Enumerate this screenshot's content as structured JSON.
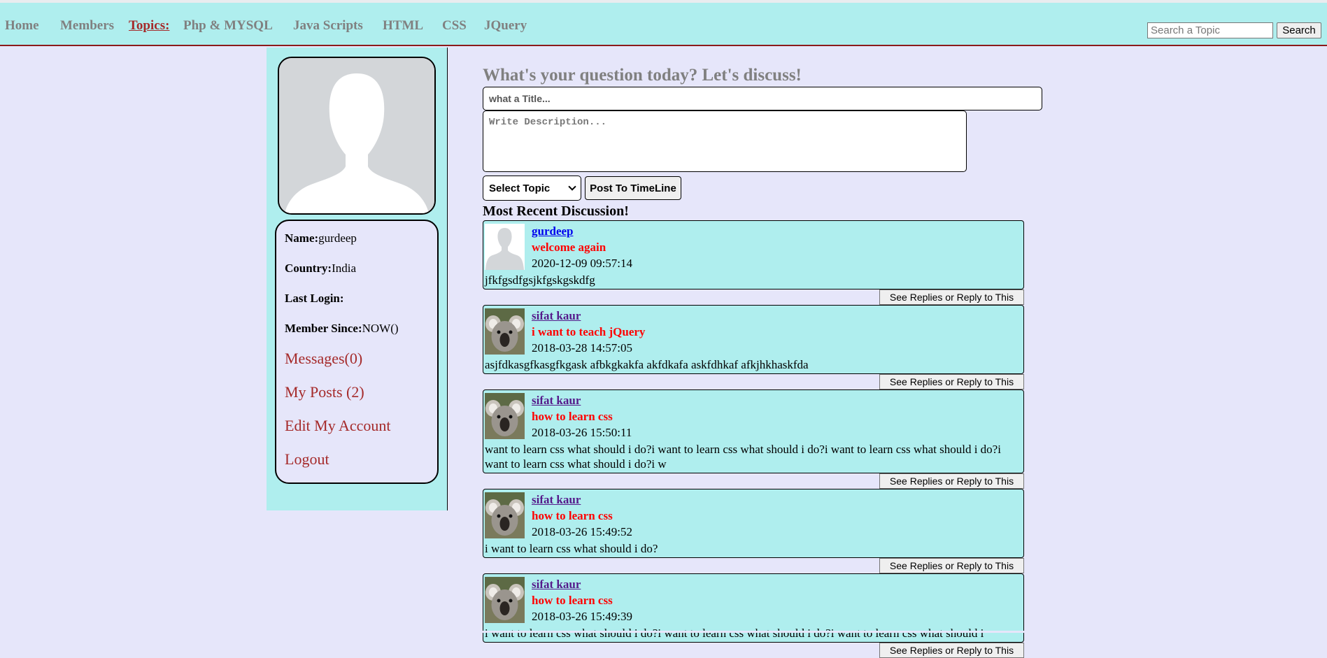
{
  "nav": {
    "home": "Home",
    "members": "Members",
    "topics": "Topics:",
    "php": "Php & MYSQL",
    "js": "Java Scripts",
    "html": "HTML",
    "css": "CSS",
    "jquery": "JQuery"
  },
  "search": {
    "placeholder": "Search a Topic",
    "button": "Search"
  },
  "profile": {
    "name_label": "Name:",
    "name": "gurdeep",
    "country_label": "Country:",
    "country": "India",
    "last_login_label": "Last Login:",
    "last_login": "",
    "since_label": "Member Since:",
    "since": "NOW()",
    "messages": "Messages(0)",
    "my_posts": "My Posts (2)",
    "edit": "Edit My Account",
    "logout": "Logout"
  },
  "composer": {
    "heading": "What's your question today? Let's discuss!",
    "title_placeholder": "what a Title...",
    "desc_placeholder": "Write Description...",
    "select_label": "Select Topic",
    "post_button": "Post To TimeLine"
  },
  "recent_heading": "Most Recent Discussion!",
  "reply_label": "See Replies or Reply to This",
  "posts": [
    {
      "author": "gurdeep",
      "title": "welcome again",
      "date": "2020-12-09 09:57:14",
      "body": "jfkfgsdfgsjkfgskgskdfg",
      "avatar": "default-avatar-icon"
    },
    {
      "author": "sifat kaur",
      "title": "i want to teach jQuery",
      "date": "2018-03-28 14:57:05",
      "body": "asjfdkasgfkasgfkgask afbkgkakfa akfdkafa askfdhkaf afkjhkhaskfda",
      "avatar": "koala-photo"
    },
    {
      "author": "sifat kaur",
      "title": "how to learn css",
      "date": "2018-03-26 15:50:11",
      "body": "want to learn css what should i do?i want to learn css what should i do?i want to learn css what should i do?i want to learn css what should i do?i w",
      "avatar": "koala-photo"
    },
    {
      "author": "sifat kaur",
      "title": "how to learn css",
      "date": "2018-03-26 15:49:52",
      "body": "i want to learn css what should i do?",
      "avatar": "koala-photo"
    },
    {
      "author": "sifat kaur",
      "title": "how to learn css",
      "date": "2018-03-26 15:49:39",
      "body": "i want to learn css what should i do?i want to learn css what should i do?i want to learn css what should i",
      "avatar": "koala-photo"
    }
  ],
  "colors": {
    "nav_bg": "#afeeee",
    "page_bg": "#e6e6fa",
    "link_red": "#a52a2a",
    "title_red": "#ff0000"
  }
}
